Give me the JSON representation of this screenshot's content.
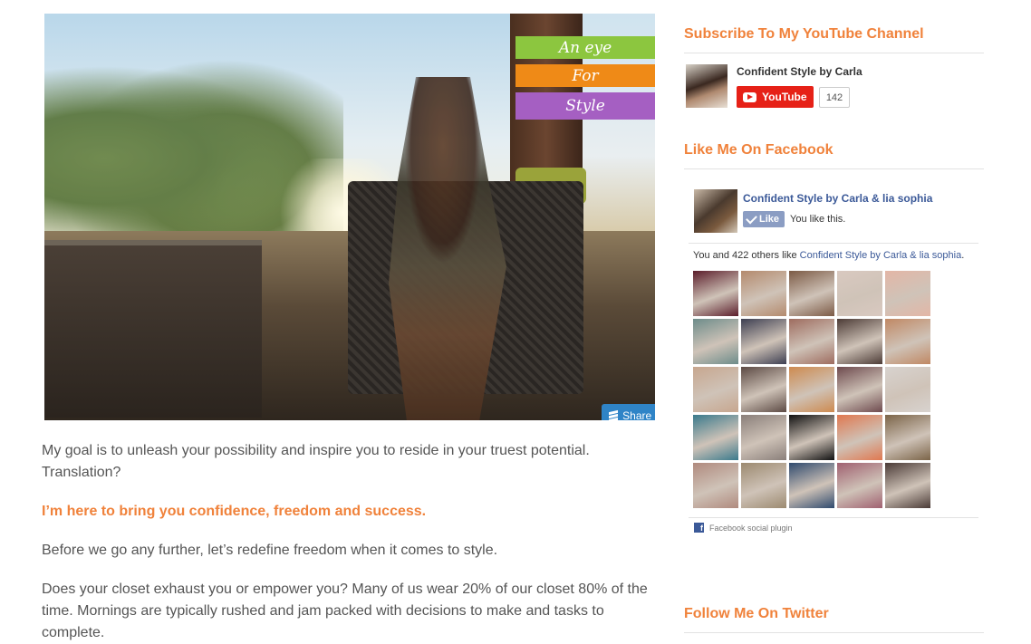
{
  "hero": {
    "logo_lines": [
      "An eye",
      "For",
      "Style"
    ],
    "share_label": "Share Image"
  },
  "content": {
    "paragraph1": "My goal is to unleash your possibility and inspire you to reside in your truest potential. Translation?",
    "highlight": "I’m here to bring you confidence, freedom and success.",
    "paragraph2": "Before we go any further, let’s redefine freedom when it comes to style.",
    "paragraph3": "Does your closet exhaust you or empower you? Many of us wear 20% of our closet 80% of the time. Mornings are typically rushed and jam packed with decisions to make and tasks to complete."
  },
  "sidebar": {
    "youtube": {
      "title": "Subscribe To My YouTube Channel",
      "channel_name": "Confident Style by Carla",
      "button_label": "YouTube",
      "subscriber_count": "142"
    },
    "facebook": {
      "title": "Like Me On Facebook",
      "page_name": "Confident Style by Carla & lia sophia",
      "like_label": "Like",
      "you_like": "You like this.",
      "others_prefix": "You and 422 others like ",
      "others_link": "Confident Style by Carla & lia sophia",
      "others_suffix": ".",
      "plugin_label": "Facebook social plugin",
      "faces": [
        "#5b1d2a",
        "#b48a6d",
        "#7c5a45",
        "#d9c9c0",
        "#e3b6a6",
        "#6d8c8a",
        "#3d3f52",
        "#9e6c5f",
        "#4c3b36",
        "#c08864",
        "#c7a68e",
        "#5c4a44",
        "#ce8a4f",
        "#6e4a4e",
        "#d8d3cf",
        "#3a7a8c",
        "#8a7f7a",
        "#111111",
        "#e07850",
        "#7b6448",
        "#b08a7e",
        "#9c8a70",
        "#2f4a6e",
        "#a06070",
        "#4a3a36"
      ]
    },
    "twitter": {
      "title": "Follow Me On Twitter"
    }
  }
}
